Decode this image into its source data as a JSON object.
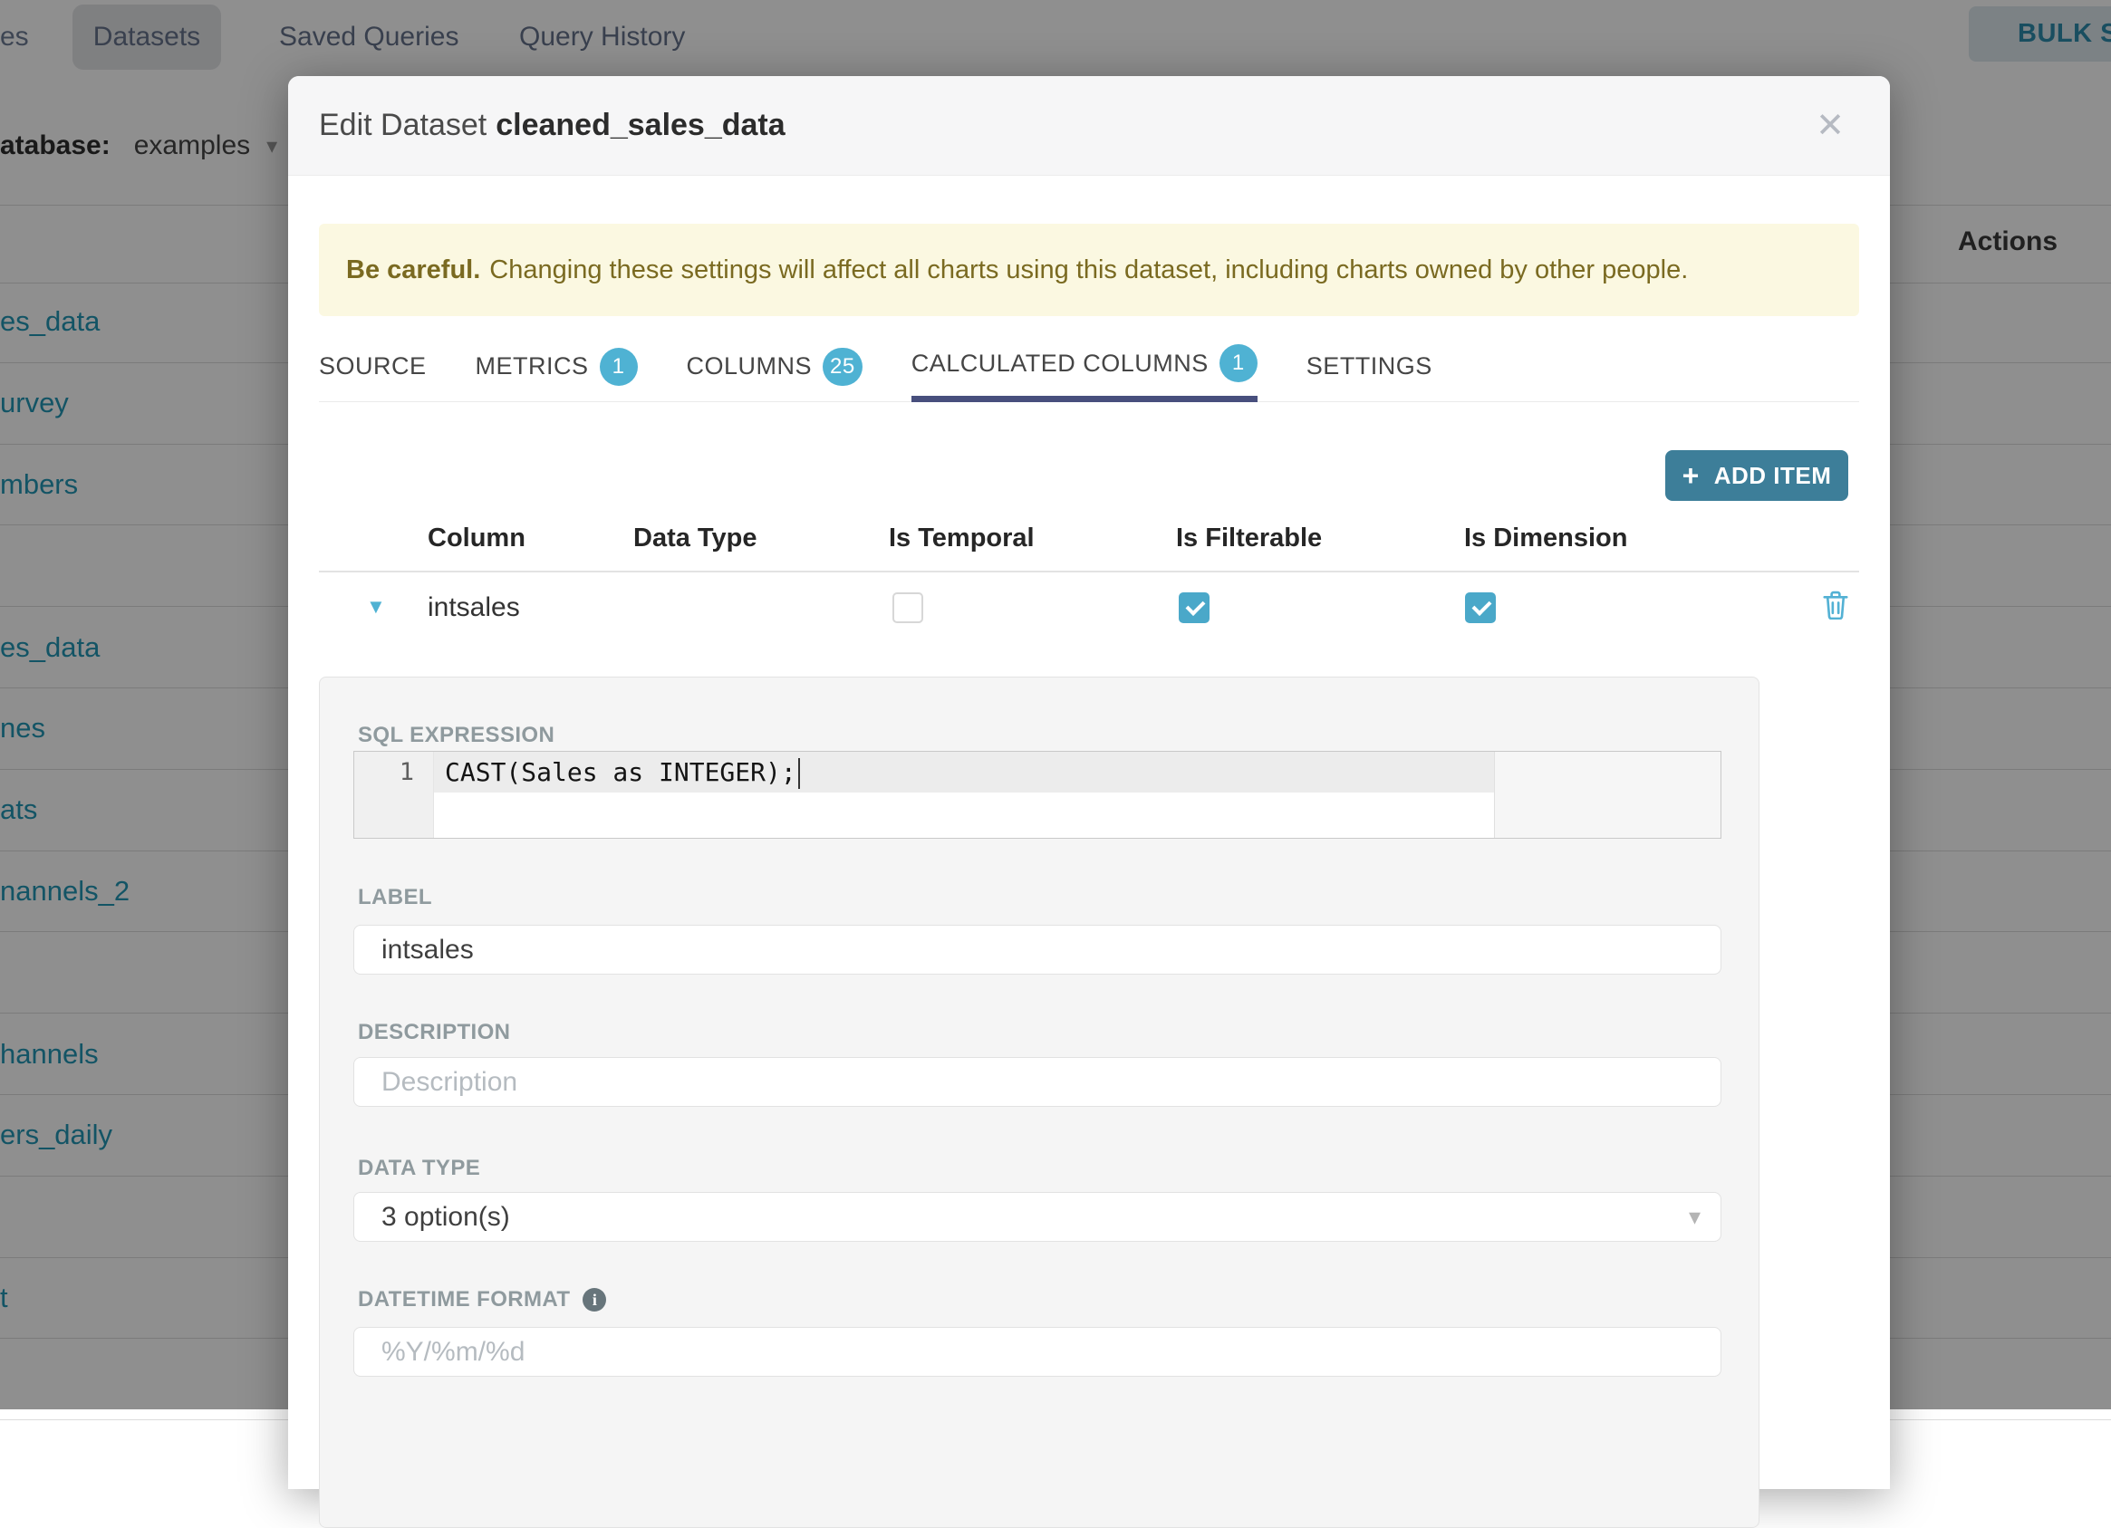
{
  "nav": {
    "cut_label": "es",
    "tabs": [
      {
        "label": "Datasets",
        "active": true
      },
      {
        "label": "Saved Queries",
        "active": false
      },
      {
        "label": "Query History",
        "active": false
      }
    ],
    "bulk_select_label": "BULK SELE"
  },
  "filter": {
    "database_label": "atabase:",
    "database_value": "examples",
    "caret_icon": "▾"
  },
  "bg_table": {
    "actions_header": "Actions",
    "rows": [
      {
        "name": "es_data"
      },
      {
        "name": "urvey"
      },
      {
        "name": "mbers"
      },
      {
        "name": ""
      },
      {
        "name": "es_data"
      },
      {
        "name": "nes"
      },
      {
        "name": "ats"
      },
      {
        "name": "nannels_2"
      },
      {
        "name": ""
      },
      {
        "name": "hannels"
      },
      {
        "name": "ers_daily"
      },
      {
        "name": ""
      },
      {
        "name": "t"
      },
      {
        "name": ""
      }
    ]
  },
  "modal": {
    "title_prefix": "Edit Dataset",
    "title_name": "cleaned_sales_data",
    "close_icon": "✕",
    "warning": {
      "bold": "Be careful.",
      "text": "Changing these settings will affect all charts using this dataset, including charts owned by other people."
    },
    "tabs": [
      {
        "label": "SOURCE",
        "badge": "",
        "active": false
      },
      {
        "label": "METRICS",
        "badge": "1",
        "active": false
      },
      {
        "label": "COLUMNS",
        "badge": "25",
        "active": false
      },
      {
        "label": "CALCULATED COLUMNS",
        "badge": "1",
        "active": true
      },
      {
        "label": "SETTINGS",
        "badge": "",
        "active": false
      }
    ],
    "add_item": {
      "icon": "+",
      "label": "ADD ITEM"
    },
    "columns_table": {
      "headers": [
        "Column",
        "Data Type",
        "Is Temporal",
        "Is Filterable",
        "Is Dimension"
      ],
      "row": {
        "column": "intsales",
        "is_temporal": false,
        "is_filterable": true,
        "is_dimension": true,
        "expand_caret": "▼"
      }
    },
    "panel": {
      "sql_label": "SQL EXPRESSION",
      "sql_line_number": "1",
      "sql_code": "CAST(Sales as INTEGER);",
      "label_label": "LABEL",
      "label_value": "intsales",
      "description_label": "DESCRIPTION",
      "description_placeholder": "Description",
      "datatype_label": "DATA TYPE",
      "datatype_value": "3 option(s)",
      "datatype_caret": "▾",
      "datetime_label": "DATETIME FORMAT",
      "info_icon": "i",
      "datetime_placeholder": "%Y/%m/%d"
    },
    "colors": {
      "accent": "#4fb2d3",
      "tab_underline": "#484f7d",
      "add_item_bg": "#3d7e99",
      "warning_bg": "#fbf8e1",
      "warning_text": "#7a6a21",
      "checkbox": "#4aa8c9"
    }
  }
}
